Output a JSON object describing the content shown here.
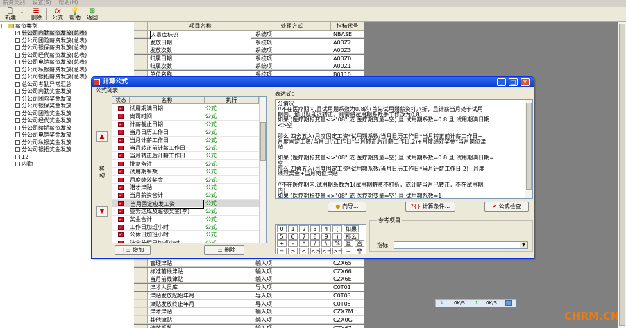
{
  "menubar": {
    "items": [
      "薪资类别",
      "设置(S)",
      "帮助(H)"
    ]
  },
  "toolbar": {
    "buttons": [
      {
        "label": "新建",
        "icon": "new-doc-icon"
      },
      {
        "label": "删除",
        "icon": "delete-icon"
      },
      {
        "label": "公式",
        "icon": "fx-icon"
      },
      {
        "label": "帮助",
        "icon": "help-icon"
      },
      {
        "label": "返回",
        "icon": "return-icon"
      }
    ]
  },
  "tree": {
    "root": "薪资类别",
    "items": [
      "分公司内勤薪资发放(总表)",
      "分公司团险薪资发放(总表)",
      "分公司银保薪资发放(总表)",
      "分公司经代薪资发放(总表)",
      "分公司电销薪资发放(总表)",
      "分公司私银薪资发放(总表)",
      "分公司银拓薪资发放(总表)",
      "总公司考勤异常汇总",
      "分公司内勤奖金发放",
      "分公司团险奖金发放",
      "分公司银保奖金发放",
      "分公司团险奖金发放",
      "分公司经代奖金发放",
      "分公司续期薪资发放",
      "分公司电销奖金发放",
      "分公司私银奖金发放",
      "分公司银拓奖金发放",
      "12",
      "内勤"
    ]
  },
  "grid": {
    "headers": [
      "项目名称",
      "处理方式",
      "指标代号"
    ],
    "rows_top": [
      [
        "人员库标识",
        "系统项",
        "NBASE"
      ],
      [
        "发放日期",
        "系统项",
        "A00Z2"
      ],
      [
        "发放次数",
        "系统项",
        "A00Z3"
      ],
      [
        "归属日期",
        "系统项",
        "A00Z0"
      ],
      [
        "归属次数",
        "系统项",
        "A00Z1"
      ],
      [
        "单位名称",
        "系统项",
        "B0110"
      ]
    ],
    "rows_bottom": [
      [
        "管理津贴",
        "输入项",
        "CZX65"
      ],
      [
        "标准前线津贴",
        "输入项",
        "CZX66"
      ],
      [
        "当月前线津贴",
        "输入项",
        "CZX6E"
      ],
      [
        "津才人员库",
        "导入项",
        "C0T01"
      ],
      [
        "津贴发放起始年月",
        "导入项",
        "C0T03"
      ],
      [
        "津贴发放终止年月",
        "导入项",
        "C0T05"
      ],
      [
        "津才津贴",
        "输入项",
        "CZX7M"
      ],
      [
        "其他津贴",
        "输入项",
        "CZX0G"
      ],
      [
        "绩效系数",
        "输入项",
        "CZX67"
      ]
    ]
  },
  "dialog": {
    "title": "计算公式",
    "formula_list_label": "公式列表",
    "list_headers": [
      "状态",
      "名称",
      "执行"
    ],
    "formulas": [
      "试用期满日期",
      "离司时间",
      "计薪截止日期",
      "当月日历工作日",
      "当月计薪工作日",
      "当月转正前计薪工作日",
      "当月转正后计薪工作日",
      "批复备注",
      "试用期系数",
      "月度绩效奖金",
      "潜才津贴",
      "当月薪资合计",
      "当月固定应发工资",
      "业务达成及超额奖金(季)",
      "奖金合计",
      "工作日加班小时",
      "公休日加班小时",
      "法定节假日加班小时"
    ],
    "formula_exec": "公式",
    "selected_index": 12,
    "move_label": "移动",
    "add_label": "增加",
    "delete_label": "删除",
    "expression_label": "表达式：",
    "expression_lines": [
      "分情况",
      "//不在医疗期内,且试用期系数为0.8的(首先试用期薪资打八折，且计薪当月处于试用",
      "期内，加出现延迟转正，则需将试用期系数手工修改为0.8)",
      "如果  (医疗期标变量<>\"08\" 或 医疗期变量=空) 且 试用期系数=0.8  且  试用期满日期",
      "<>空",
      "",
      "那么  四舍五入(月度固定工资*试用期系数/当月日历工作日*当月转正前计薪工作日+",
      "月度固定工资/当月日历工作日*当月转正后计薪工作日,2)+月度绩效奖金*当月岗位津",
      "贴",
      "",
      "如果  (医疗期标变量<>\"08\" 或 医疗期变量=空) 且 试用期系数=0.8  且  试用期满日期=",
      "空",
      "那么  四舍五入(月度固定工资*试用期系数/当月日历工作日*当月计薪工作日,2)+月度",
      "绩效奖金+当月岗位津贴",
      "",
      "//不在医疗期内,试用期系数为1(试用期薪资不打折，或计薪当月已转正，不在试用期",
      "内)",
      "如果  (医疗期标变量<>\"08\" 或 医疗期变量=空) 且 试用期系数=1"
    ],
    "wizard_label": "向导...",
    "condition_label": "计算条件...",
    "check_label": "公式检查",
    "keys": [
      [
        "0",
        "1",
        "2",
        "3",
        "4",
        "(",
        "如果"
      ],
      [
        "5",
        "6",
        "7",
        "8",
        "9",
        ")",
        "那么"
      ],
      [
        "+",
        "-",
        "*",
        "/",
        "\\",
        "%",
        "且",
        "否"
      ],
      [
        "=",
        ">",
        "<",
        "<>",
        "<=",
        ">=",
        "~",
        "非"
      ]
    ],
    "ref_group_label": "参考项目",
    "indicator_label": "指标",
    "indicator_value": ""
  },
  "netwidget": {
    "down": "0K/S",
    "up": "0K/S"
  },
  "watermark": "CHRM.CN"
}
